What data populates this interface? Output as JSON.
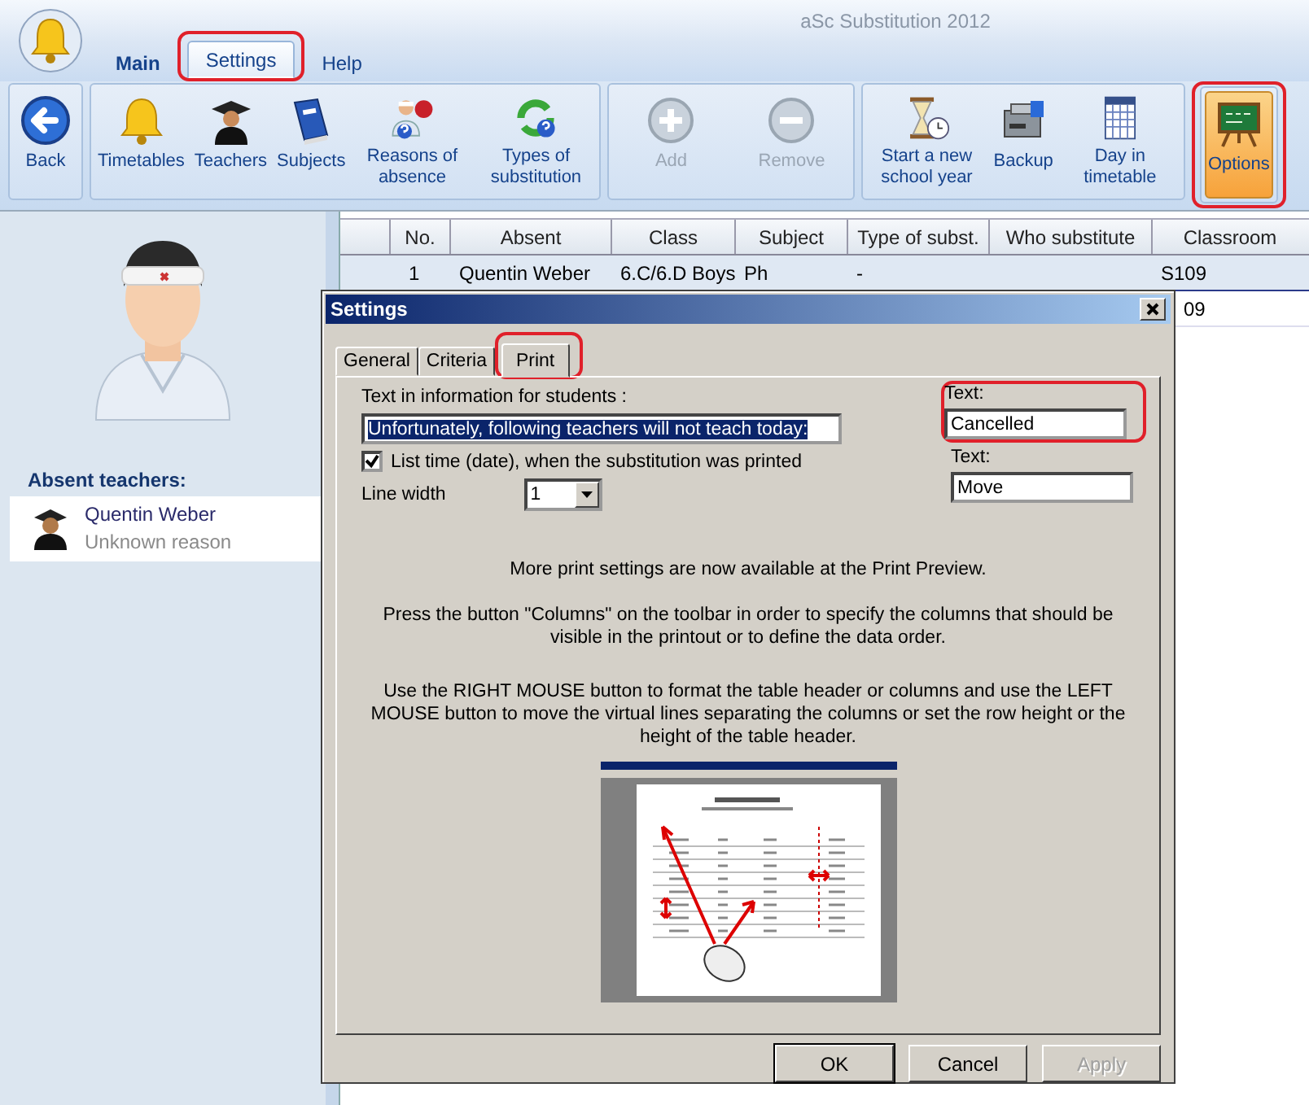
{
  "window": {
    "title": "aSc Substitution 2012"
  },
  "ribbon_tabs": [
    {
      "label": "Main",
      "selected": false
    },
    {
      "label": "Settings",
      "selected": true,
      "annotated": true
    },
    {
      "label": "Help",
      "selected": false
    }
  ],
  "ribbon_groups": [
    {
      "buttons": [
        {
          "label": "Back",
          "kind": "back",
          "disabled": false,
          "selected": false
        }
      ]
    },
    {
      "buttons": [
        {
          "label": "Timetables",
          "kind": "bell",
          "disabled": false,
          "selected": false
        },
        {
          "label": "Teachers",
          "kind": "teacher",
          "disabled": false,
          "selected": false
        },
        {
          "label": "Subjects",
          "kind": "book",
          "disabled": false,
          "selected": false
        },
        {
          "label": "Reasons of absence",
          "kind": "reasons",
          "disabled": false,
          "selected": false
        },
        {
          "label": "Types of substitution",
          "kind": "types",
          "disabled": false,
          "selected": false
        }
      ]
    },
    {
      "buttons": [
        {
          "label": "Add",
          "kind": "add",
          "disabled": true,
          "selected": false
        },
        {
          "label": "Remove",
          "kind": "remove",
          "disabled": true,
          "selected": false
        }
      ]
    },
    {
      "buttons": [
        {
          "label": "Start a new school year",
          "kind": "hourglass",
          "disabled": false,
          "selected": false
        },
        {
          "label": "Backup",
          "kind": "backup",
          "disabled": false,
          "selected": false
        },
        {
          "label": "Day in timetable",
          "kind": "calendar",
          "disabled": false,
          "selected": false
        }
      ]
    },
    {
      "buttons": [
        {
          "label": "Options",
          "kind": "board",
          "disabled": false,
          "selected": true
        }
      ],
      "annotated": true
    }
  ],
  "absent_panel": {
    "heading": "Absent teachers:",
    "teachers": [
      {
        "name": "Quentin Weber",
        "reason": "Unknown reason"
      }
    ]
  },
  "table": {
    "columns": [
      "No.",
      "Absent",
      "Class",
      "Subject",
      "Type of subst.",
      "Who substitute",
      "Classroom"
    ],
    "rows": [
      {
        "no": "1",
        "absent": "Quentin Weber",
        "class": "6.C/6.D Boys",
        "subject": "Ph",
        "type": "-",
        "classroom": "S109",
        "selected": true
      },
      {
        "classroom": "09",
        "selected": false
      }
    ]
  },
  "dialog": {
    "title": "Settings",
    "tabs": [
      {
        "label": "General",
        "selected": false
      },
      {
        "label": "Criteria",
        "selected": false
      },
      {
        "label": "Print",
        "selected": true,
        "annotated": true
      }
    ],
    "info_label": "Text in information for students :",
    "info_value": "Unfortunately, following teachers will not teach today:",
    "info_value_selected": true,
    "list_time": {
      "label": "List time (date), when the substitution was printed",
      "checked": true
    },
    "line_width": {
      "label": "Line width",
      "value": "1"
    },
    "text_fields": [
      {
        "label": "Text:",
        "value": "Cancelled",
        "annotated": true
      },
      {
        "label": "Text:",
        "value": "Move"
      }
    ],
    "notes": [
      "More print settings are now available at the Print Preview.",
      "Press the button \"Columns\" on the toolbar in order to specify the columns that should be visible in the printout or to define the data order.",
      "Use the RIGHT MOUSE button to format the table header or columns and use the LEFT MOUSE button to move the virtual lines separating the columns or set the row height or the height of the table header."
    ],
    "buttons": [
      {
        "label": "OK",
        "default": true,
        "disabled": false
      },
      {
        "label": "Cancel",
        "default": false,
        "disabled": false
      },
      {
        "label": "Apply",
        "default": false,
        "disabled": true
      }
    ]
  }
}
